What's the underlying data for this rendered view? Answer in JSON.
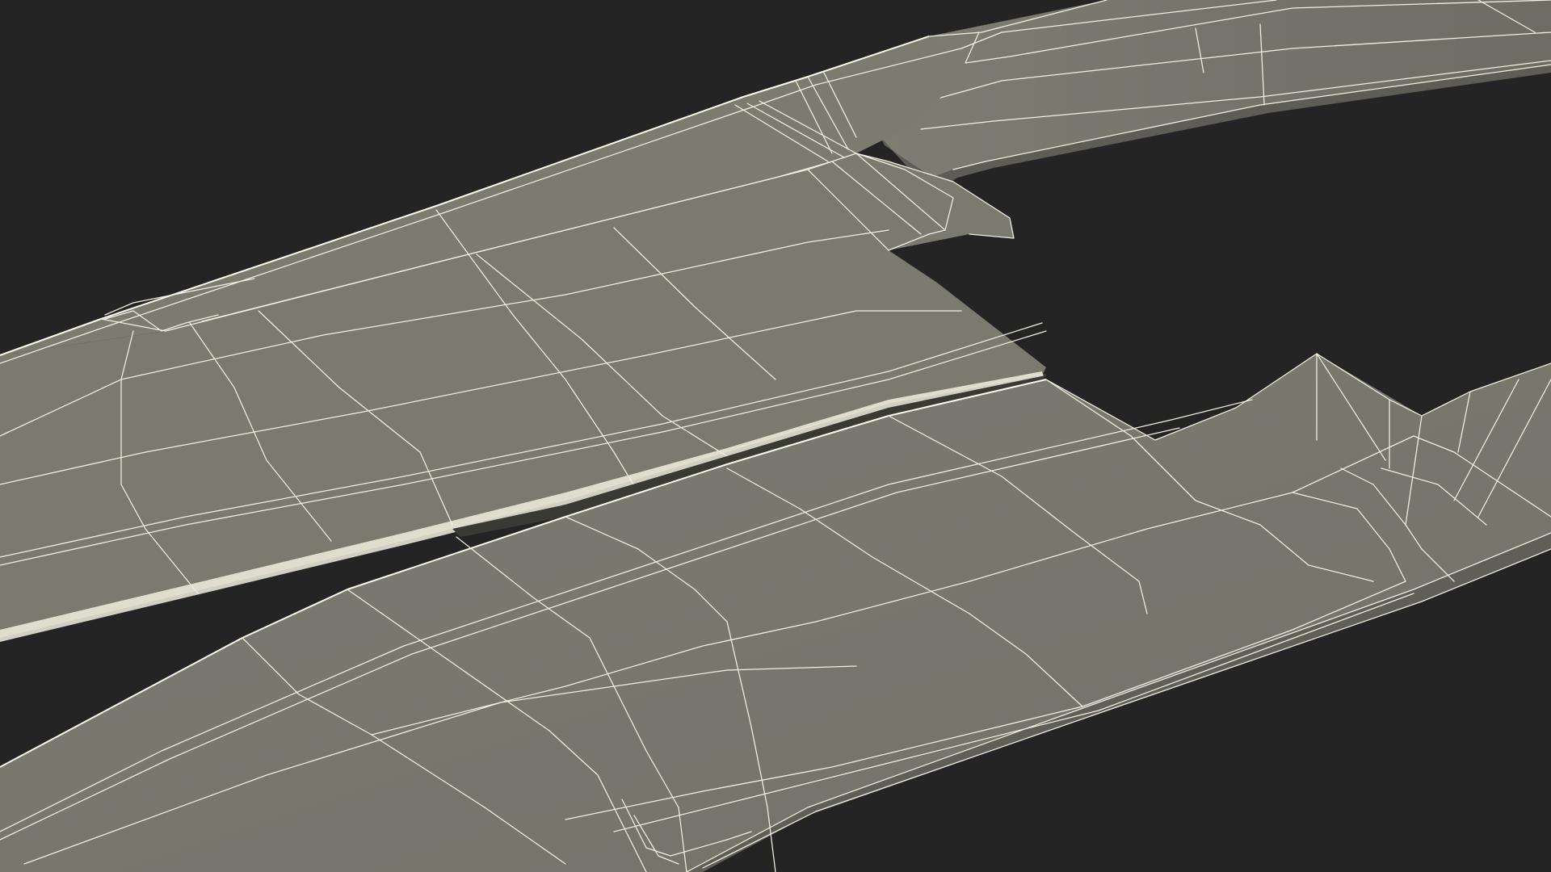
{
  "scene": {
    "subject": "wing-wireframe-render",
    "background_color": "#242424",
    "surface_color": "#7b7b70",
    "surface_shade_color": "#6f6f66",
    "edge_color": "#f2f0e2"
  }
}
